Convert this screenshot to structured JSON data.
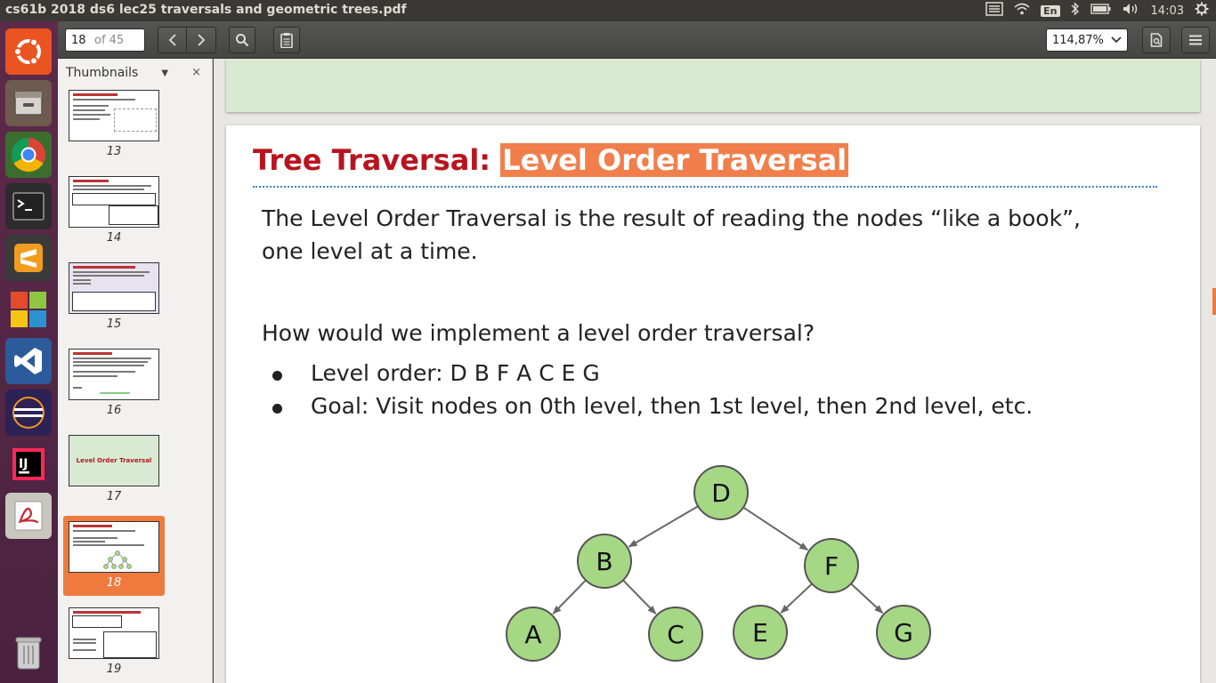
{
  "window": {
    "title": "cs61b 2018 ds6 lec25 traversals and geometric trees.pdf",
    "keyboard": "En",
    "clock": "14:03"
  },
  "launcher": {
    "apps": [
      "ubuntu-logo",
      "files",
      "chrome",
      "terminal",
      "sublime-text",
      "libreoffice",
      "vscode",
      "eclipse",
      "intellij",
      "pdf-viewer",
      "trash"
    ]
  },
  "toolbar": {
    "page_current": "18",
    "page_total": "of 45",
    "zoom": "114,87%"
  },
  "sidebar": {
    "title": "Thumbnails",
    "close": "×",
    "thumbnails": [
      {
        "num": "13"
      },
      {
        "num": "14"
      },
      {
        "num": "15"
      },
      {
        "num": "16"
      },
      {
        "num": "17",
        "caption": "Level Order Traversal"
      },
      {
        "num": "18"
      },
      {
        "num": "19"
      }
    ],
    "selected": "18"
  },
  "slide": {
    "title_part1": "Tree Traversal: ",
    "title_part2": "Level Order Traversal",
    "line1": "The Level Order Traversal is the result of reading the nodes “like a book”,",
    "line2": "one level at a time.",
    "question": "How would we implement a level order traversal?",
    "bullets": [
      "Level order: D B F A C E G",
      "Goal: Visit nodes on 0th level, then 1st level, then 2nd level, etc."
    ],
    "tree": {
      "nodes": [
        "D",
        "B",
        "F",
        "A",
        "C",
        "E",
        "G"
      ],
      "edges": [
        [
          "D",
          "B"
        ],
        [
          "D",
          "F"
        ],
        [
          "B",
          "A"
        ],
        [
          "B",
          "C"
        ],
        [
          "F",
          "E"
        ],
        [
          "F",
          "G"
        ]
      ],
      "node_fill": "#a6d785",
      "node_stroke": "#555555"
    }
  },
  "colors": {
    "title_red": "#b8141f",
    "highlight_orange": "#f07f4c",
    "selection_orange": "#ee7a3e",
    "dotted_blue": "#3d85c6",
    "prev_slide_green": "#d9ead3"
  }
}
